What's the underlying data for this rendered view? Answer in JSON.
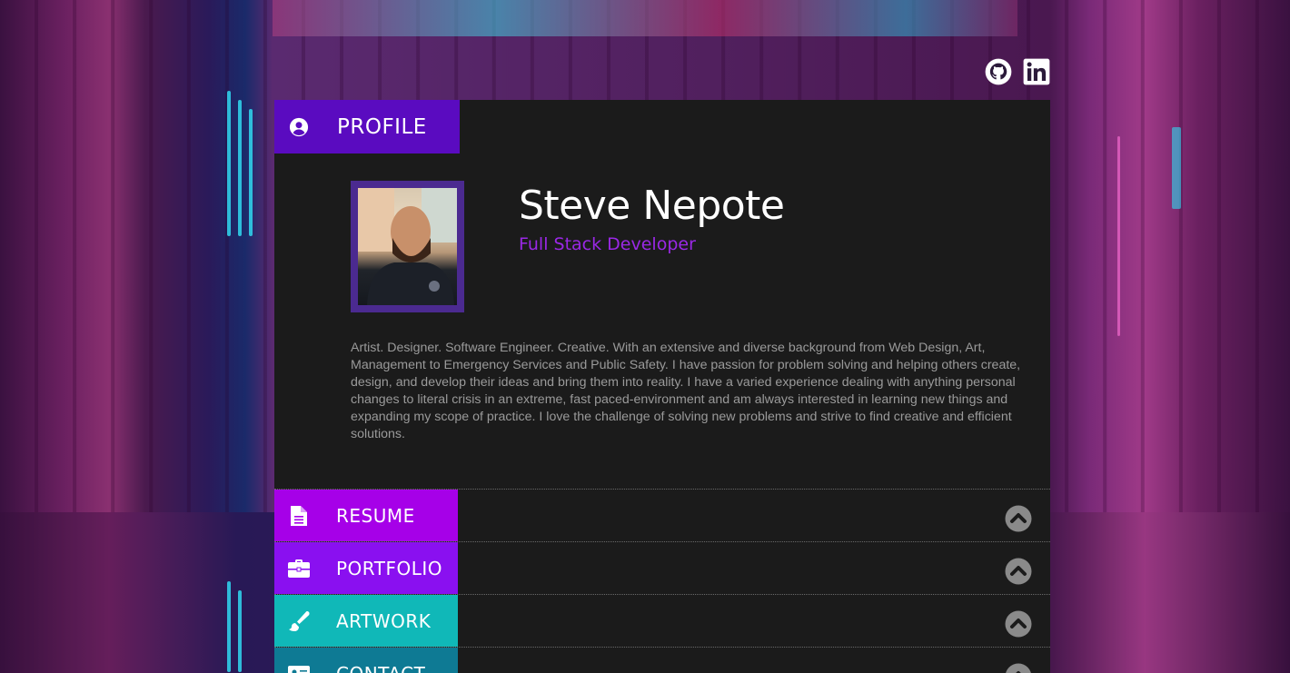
{
  "social": {
    "github_icon": "github-icon",
    "linkedin_icon": "linkedin-icon"
  },
  "profile": {
    "tab_label": "PROFILE",
    "name": "Steve Nepote",
    "title": "Full Stack Developer",
    "bio": "Artist. Designer. Software Engineer. Creative. With an extensive and diverse background from Web Design, Art, Management to Emergency Services and Public Safety. I have passion for problem solving and helping others create, design, and develop their ideas and bring them into reality. I have a varied experience dealing with anything personal changes to literal crisis in an extreme, fast paced-environment and am always interested in learning new things and expanding my scope of practice. I love the challenge of solving new problems and strive to find creative and efficient solutions."
  },
  "sections": [
    {
      "label": "RESUME",
      "icon": "document-icon"
    },
    {
      "label": "PORTFOLIO",
      "icon": "briefcase-icon"
    },
    {
      "label": "ARTWORK",
      "icon": "paintbrush-icon"
    },
    {
      "label": "CONTACT",
      "icon": "id-card-icon"
    }
  ],
  "colors": {
    "profile_tab": "#5a0bc0",
    "resume_tab": "#a600e8",
    "portfolio_tab": "#8a10f0",
    "artwork_tab": "#10b8b8",
    "contact_tab": "#0e7a94",
    "accent_title": "#9a28e6",
    "card_bg": "#1b1b1b"
  }
}
